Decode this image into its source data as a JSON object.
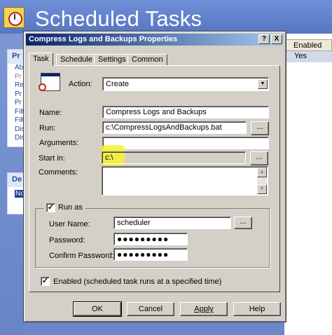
{
  "background": {
    "title": "Scheduled Tasks",
    "left_panel": {
      "head": "Pr",
      "items": [
        "Ab",
        "Pr",
        "Re",
        "Pr",
        "Pr",
        "Filt",
        "Filt",
        "Dis",
        "Dis"
      ],
      "dimmed": [
        false,
        true,
        false,
        false,
        false,
        false,
        false,
        false,
        false
      ]
    },
    "details_panel": {
      "head": "De",
      "selected": "No"
    },
    "list": {
      "column_header": "Enabled",
      "value": "Yes"
    }
  },
  "dialog": {
    "title": "Compress Logs and Backups Properties",
    "help_glyph": "?",
    "close_glyph": "X",
    "tabs": [
      "Task",
      "Schedule",
      "Settings",
      "Common"
    ],
    "active_tab": "Task",
    "action": {
      "label": "Action:",
      "value": "Create"
    },
    "name": {
      "label": "Name:",
      "value": "Compress Logs and Backups"
    },
    "run": {
      "label": "Run:",
      "value": "c:\\CompressLogsAndBackups.bat"
    },
    "arguments": {
      "label": "Arguments:",
      "value": ""
    },
    "start_in": {
      "label": "Start in:",
      "value": "c:\\"
    },
    "comments": {
      "label": "Comments:",
      "value": ""
    },
    "browse_label": "...",
    "run_as": {
      "label": "Run as",
      "checked": true,
      "user_name": {
        "label": "User Name:",
        "value": "scheduler"
      },
      "password": {
        "label": "Password:",
        "value": "●●●●●●●●●"
      },
      "confirm_password": {
        "label": "Confirm Password:",
        "value": "●●●●●●●●●"
      }
    },
    "enabled": {
      "label": "Enabled (scheduled task runs at a specified time)",
      "checked": true
    },
    "buttons": {
      "ok": "OK",
      "cancel": "Cancel",
      "apply": "Apply",
      "help": "Help"
    }
  },
  "colors": {
    "title_bar_start": "#0a246a",
    "title_bar_end": "#a6caf0",
    "dialog_face": "#d4d0c8",
    "highlight": "#f7f22c",
    "background_blue": "#6b86c9"
  }
}
